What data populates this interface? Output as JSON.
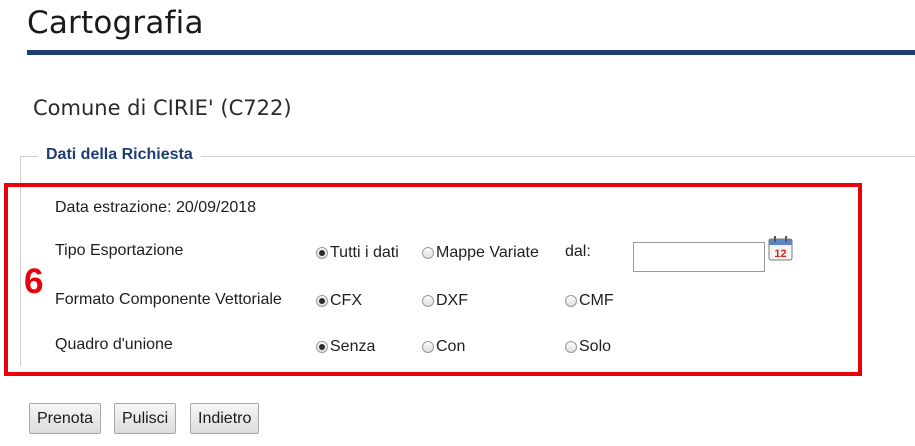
{
  "page": {
    "title": "Cartografia",
    "subtitle": "Comune di CIRIE' (C722)",
    "accent_color": "#1f3f74",
    "highlight_color": "#e8000b"
  },
  "section": {
    "legend": "Dati della Richiesta",
    "annotation_number": "6",
    "data_estrazione": "Data estrazione: 20/09/2018"
  },
  "rows": {
    "tipo": {
      "label": "Tipo Esportazione",
      "options": [
        "Tutti i dati",
        "Mappe Variate"
      ],
      "selected": "Tutti i dati",
      "dal_label": "dal:",
      "dal_value": ""
    },
    "formato": {
      "label": "Formato Componente Vettoriale",
      "options": [
        "CFX",
        "DXF",
        "CMF"
      ],
      "selected": "CFX"
    },
    "quadro": {
      "label": "Quadro d'unione",
      "options": [
        "Senza",
        "Con",
        "Solo"
      ],
      "selected": "Senza"
    }
  },
  "calendar": {
    "icon": "calendar-icon",
    "day": "12"
  },
  "buttons": {
    "prenota": "Prenota",
    "pulisci": "Pulisci",
    "indietro": "Indietro"
  }
}
